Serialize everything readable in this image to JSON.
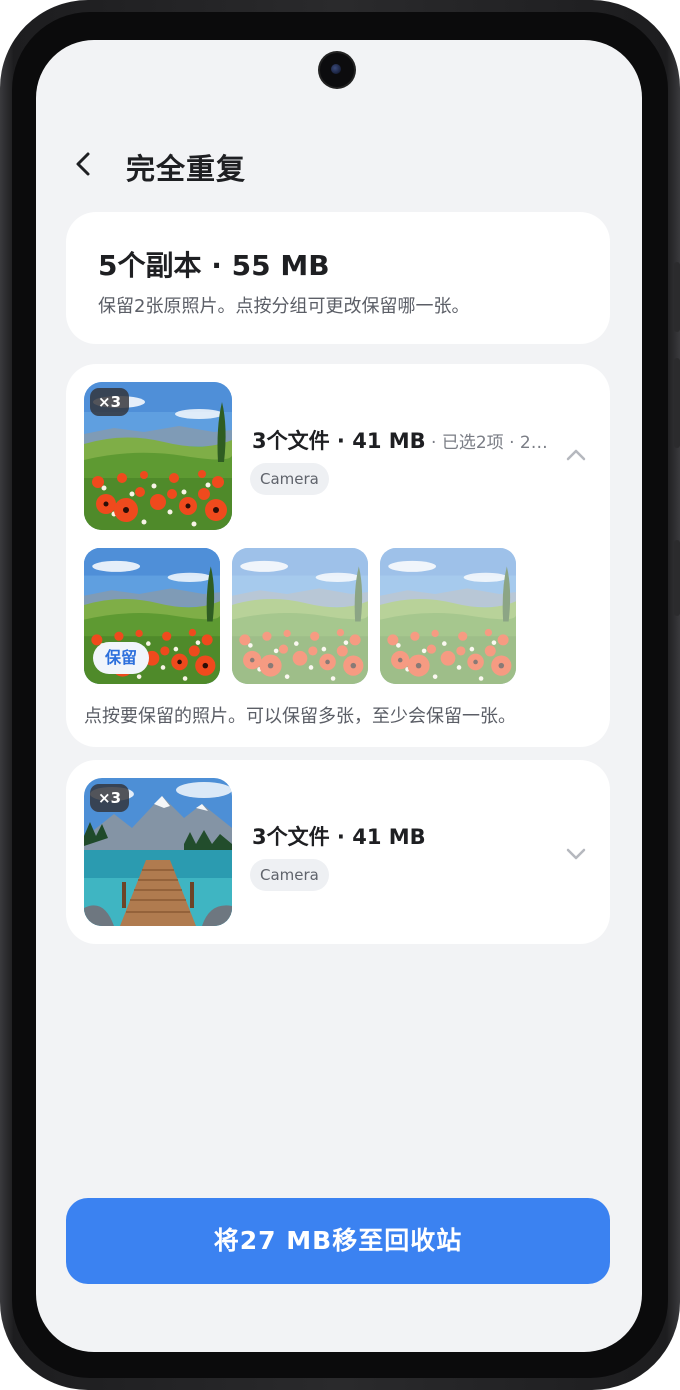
{
  "header": {
    "title": "完全重复"
  },
  "summary": {
    "title": "5个副本 · 55 MB",
    "description": "保留2张原照片。点按分组可更改保留哪一张。"
  },
  "groups": [
    {
      "count_badge": "×3",
      "title": "3个文件 · 41 MB",
      "selection": " · 已选2项 · 2…",
      "source": "Camera",
      "expanded": true,
      "keep_label": "保留",
      "hint": "点按要保留的照片。可以保留多张，至少会保留一张。"
    },
    {
      "count_badge": "×3",
      "title": "3个文件 · 41 MB",
      "source": "Camera",
      "expanded": false
    }
  ],
  "actions": {
    "move_to_trash": "将27 MB移至回收站"
  },
  "colors": {
    "accent": "#3b82f1",
    "background": "#f2f3f5"
  }
}
